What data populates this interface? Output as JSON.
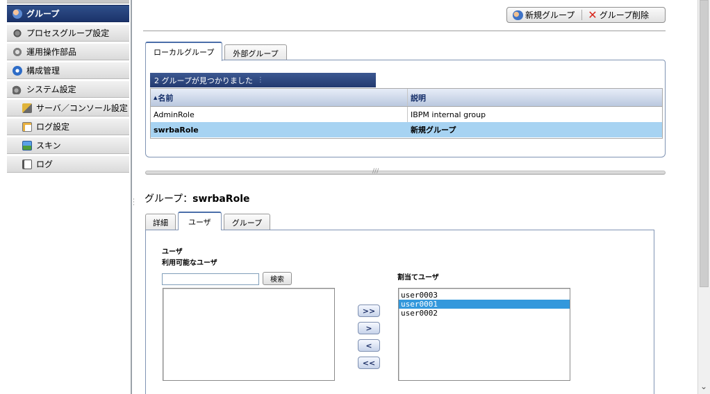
{
  "sidebar": {
    "items": [
      {
        "label": "グループ",
        "icon": "users-icon"
      },
      {
        "label": "プロセスグループ設定",
        "icon": "tools-icon"
      },
      {
        "label": "運用操作部品",
        "icon": "gear-icon"
      },
      {
        "label": "構成管理",
        "icon": "config-icon"
      },
      {
        "label": "システム設定",
        "icon": "settings-icon"
      },
      {
        "label": "サーバ／コンソール設定",
        "icon": "server-icon"
      },
      {
        "label": "ログ設定",
        "icon": "log-settings-icon"
      },
      {
        "label": "スキン",
        "icon": "skin-icon"
      },
      {
        "label": "ログ",
        "icon": "log-icon"
      }
    ]
  },
  "toolbar": {
    "new_group": "新規グループ",
    "delete_group": "グループ削除"
  },
  "group_tabs": {
    "local": "ローカルグループ",
    "external": "外部グループ"
  },
  "group_list": {
    "found_text": "2 グループが見つかりました",
    "col_name": "名前",
    "col_desc": "説明",
    "rows": [
      {
        "name": "AdminRole",
        "desc": "IBPM internal group"
      },
      {
        "name": "swrbaRole",
        "desc": "新規グループ"
      }
    ]
  },
  "detail": {
    "title_prefix": "グループ：",
    "title_name": "swrbaRole",
    "tabs": {
      "details": "詳細",
      "user": "ユーザ",
      "group": "グループ"
    },
    "user_label": "ユーザ",
    "available_label": "利用可能なユーザ",
    "assigned_label": "割当てユーザ",
    "search_button": "検索",
    "search_value": "",
    "assigned_users": [
      "user0003",
      "user0001",
      "user0002"
    ],
    "selected_assigned": "user0001",
    "move_buttons": {
      "add_all": ">>",
      "add": ">",
      "remove": "<",
      "remove_all": "<<"
    }
  },
  "colors": {
    "nav_active": "#1b336a",
    "selection": "#a7d3f2",
    "list_selection": "#3398dc",
    "delete_red": "#d8261c"
  }
}
